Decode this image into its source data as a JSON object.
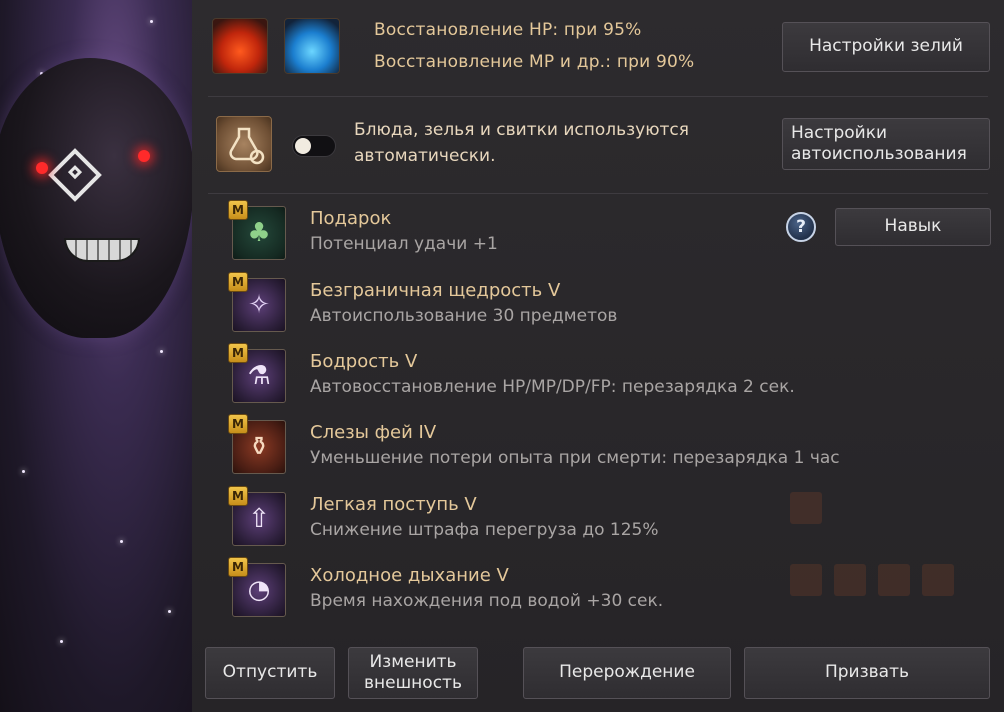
{
  "potions": {
    "hp_label": "Восстановление HP: при 95%",
    "mp_label": "Восстановление MP и др.: при 90%",
    "settings_button": "Настройки зелий"
  },
  "auto_use": {
    "enabled": false,
    "text": "Блюда, зелья и свитки используются автоматически.",
    "settings_button": "Настройки автоиспользования"
  },
  "skills_header": {
    "help_glyph": "?",
    "skill_button": "Навык"
  },
  "skills": [
    {
      "badge": "M",
      "name": "Подарок",
      "description": "Потенциал удачи +1",
      "icon": "clover-icon"
    },
    {
      "badge": "M",
      "name": "Безграничная щедрость V",
      "description": "Автоиспользование 30 предметов",
      "icon": "fairy-icon"
    },
    {
      "badge": "M",
      "name": "Бодрость V",
      "description": "Автовосстановление HP/MP/DP/FP: перезарядка 2 сек.",
      "icon": "potion-plus-icon"
    },
    {
      "badge": "M",
      "name": "Слезы фей IV",
      "description": "Уменьшение потери опыта при смерти: перезарядка 1 час",
      "icon": "vase-icon"
    },
    {
      "badge": "M",
      "name": "Легкая поступь V",
      "description": "Снижение штрафа перегруза до 125%",
      "icon": "weight-arrow-icon"
    },
    {
      "badge": "M",
      "name": "Холодное дыхание V",
      "description": "Время нахождения под водой +30 сек.",
      "icon": "bubble-timer-icon"
    }
  ],
  "footer": {
    "release_button": "Отпустить",
    "change_look_button": "Изменить внешность",
    "rebirth_button": "Перерождение",
    "summon_button": "Призвать"
  },
  "colors": {
    "gold_text": "#e4c89a",
    "desc_text": "#a9a5a4",
    "panel_bg": "#2d2b2e"
  }
}
